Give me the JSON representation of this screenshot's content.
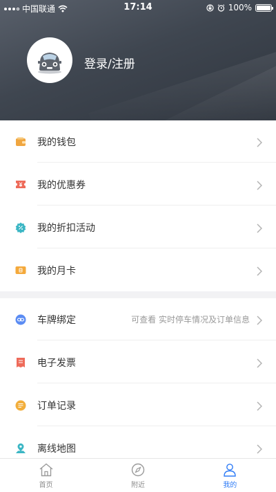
{
  "status_bar": {
    "carrier": "中国联通",
    "time": "17:14",
    "battery": "100%"
  },
  "profile": {
    "login_label": "登录/注册",
    "avatar_icon": "car-avatar-icon"
  },
  "colors": {
    "header_dark": "#3f4650",
    "accent_blue": "#2f7cf6",
    "wallet": "#f0a640",
    "coupon": "#ee6b5a",
    "discount": "#3bb6c4",
    "monthcard": "#f4a93b",
    "plate": "#5b8cf3",
    "invoice": "#ee6b5a",
    "orders": "#f2ae3c",
    "map": "#3bb6c4"
  },
  "menu_group_1": [
    {
      "label": "我的钱包",
      "icon": "wallet-icon"
    },
    {
      "label": "我的优惠券",
      "icon": "coupon-icon"
    },
    {
      "label": "我的折扣活动",
      "icon": "discount-icon"
    },
    {
      "label": "我的月卡",
      "icon": "month-card-icon"
    }
  ],
  "menu_group_2": [
    {
      "label": "车牌绑定",
      "hint": "可查看 实时停车情况及订单信息",
      "icon": "plate-link-icon"
    },
    {
      "label": "电子发票",
      "icon": "invoice-icon"
    },
    {
      "label": "订单记录",
      "icon": "order-record-icon"
    },
    {
      "label": "离线地图",
      "icon": "offline-map-icon"
    }
  ],
  "tabbar": [
    {
      "label": "首页",
      "icon": "home-icon"
    },
    {
      "label": "附近",
      "icon": "compass-icon"
    },
    {
      "label": "我的",
      "icon": "user-icon",
      "active": true
    }
  ]
}
